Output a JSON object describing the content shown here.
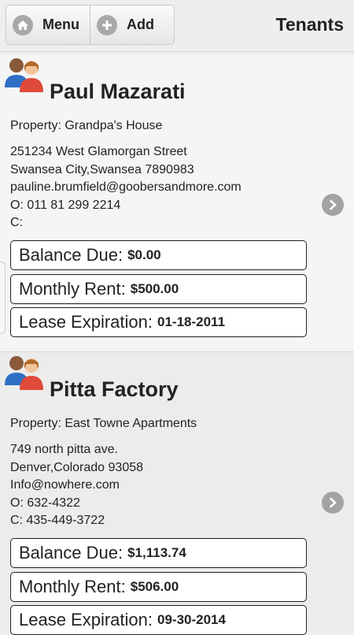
{
  "header": {
    "title": "Tenants",
    "menu_label": "Menu",
    "add_label": "Add"
  },
  "tenants": [
    {
      "name": "Paul Mazarati",
      "property": "Property: Grandpa's House",
      "address_lines": [
        "251234 West Glamorgan Street",
        "Swansea City,Swansea 7890983"
      ],
      "email": "pauline.brumfield@goobersandmore.com",
      "office_phone": "O: 011 81 299 2214",
      "cell_phone": "C:",
      "balance_label": "Balance Due:",
      "balance_value": "$0.00",
      "rent_label": "Monthly Rent:",
      "rent_value": "$500.00",
      "lease_label": "Lease Expiration:",
      "lease_value": "01-18-2011"
    },
    {
      "name": "Pitta Factory",
      "property": "Property: East Towne Apartments",
      "address_lines": [
        "749 north pitta ave.",
        "Denver,Colorado 93058"
      ],
      "email": "Info@nowhere.com",
      "office_phone": "O: 632-4322",
      "cell_phone": "C: 435-449-3722",
      "balance_label": "Balance Due:",
      "balance_value": "$1,113.74",
      "rent_label": "Monthly Rent:",
      "rent_value": "$506.00",
      "lease_label": "Lease Expiration:",
      "lease_value": "09-30-2014"
    }
  ],
  "icons": {
    "menu": "home-icon",
    "add": "plus-icon",
    "avatar": "tenant-avatar-icon",
    "detail": "chevron-right-icon"
  }
}
